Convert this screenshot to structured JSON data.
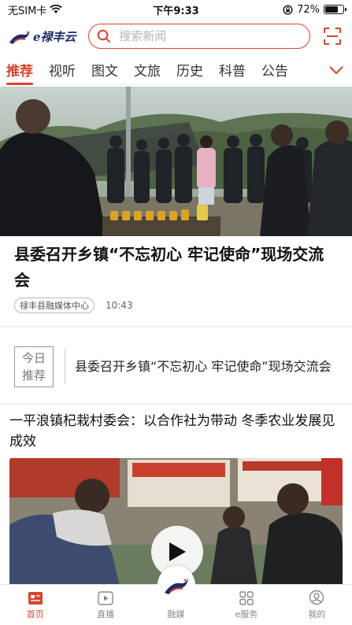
{
  "status_bar": {
    "carrier": "无SIM卡",
    "time": "下午9:33",
    "battery_pct": "72%",
    "battery_level": 0.72
  },
  "header": {
    "logo_text": "e禄丰云",
    "search_placeholder": "搜索新闻"
  },
  "tabs": [
    {
      "label": "推荐",
      "active": true
    },
    {
      "label": "视听"
    },
    {
      "label": "图文"
    },
    {
      "label": "文旅"
    },
    {
      "label": "历史"
    },
    {
      "label": "科普"
    },
    {
      "label": "公告"
    }
  ],
  "hero": {
    "title": "县委召开乡镇“不忘初心 牢记使命”现场交流会",
    "source": "禄丰县融媒体中心",
    "time": "10:43"
  },
  "today": {
    "badge_line1": "今日",
    "badge_line2": "推荐",
    "text": "县委召开乡镇“不忘初心 牢记使命”现场交流会"
  },
  "article2": {
    "title": "一平浪镇杞栽村委会：以合作社为带动 冬季农业发展见成效"
  },
  "bottom_nav": [
    {
      "label": "首页",
      "icon": "news-icon",
      "active": true
    },
    {
      "label": "直播",
      "icon": "live-play-icon"
    },
    {
      "label": "融媒",
      "icon": "media-dragon-icon"
    },
    {
      "label": "e服务",
      "icon": "grid-service-icon"
    },
    {
      "label": "我的",
      "icon": "profile-icon"
    }
  ],
  "colors": {
    "accent": "#d8442f",
    "brand_navy": "#1c2b6b"
  }
}
